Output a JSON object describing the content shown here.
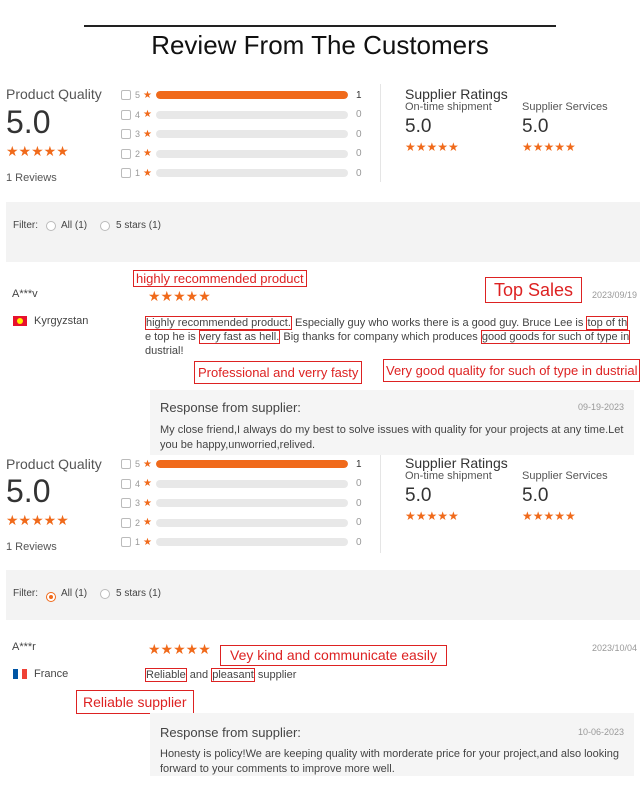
{
  "title": "Review From The Customers",
  "colors": {
    "accent": "#f06a1b",
    "annotation": "#dd2222"
  },
  "block1": {
    "product_quality_label": "Product Quality",
    "score": "5.0",
    "stars": "★★★★★",
    "reviews": "1 Reviews",
    "bars": [
      {
        "star": "5",
        "count": "1",
        "fill": 1.0
      },
      {
        "star": "4",
        "count": "0",
        "fill": 0
      },
      {
        "star": "3",
        "count": "0",
        "fill": 0
      },
      {
        "star": "2",
        "count": "0",
        "fill": 0
      },
      {
        "star": "1",
        "count": "0",
        "fill": 0
      }
    ],
    "supplier_ratings_label": "Supplier Ratings",
    "ontime_label": "On-time shipment",
    "ontime_score": "5.0",
    "service_label": "Supplier Services",
    "service_score": "5.0",
    "filter": {
      "label": "Filter:",
      "all": "All (1)",
      "five": "5 stars (1)",
      "selected": "none"
    },
    "review": {
      "reviewer": "A***v",
      "country": "Kyrgyzstan",
      "date": "2023/09/19",
      "stars": "★★★★★",
      "text_parts": {
        "p1": "highly recommended product.",
        "p2": " Especially guy who works there is a good guy. Bruce Lee is ",
        "p3": "top of th",
        "p4": "e top he is ",
        "p5": "very fast as hell.",
        "p6": " Big thanks for company which produces ",
        "p7": "good goods for such of type in",
        "p8": "dustrial!"
      }
    },
    "annotations": {
      "a1": "highly recommended product",
      "a2": "Top Sales",
      "a3": "Professional and verry fasty",
      "a4": "Very good quality for such of type in dustrial"
    },
    "response": {
      "title": "Response from supplier:",
      "date": "09-19-2023",
      "text": "My close friend,I always do my best to solve issues with quality for your projects at any time.Let you be happy,unworried,relived."
    }
  },
  "block2": {
    "product_quality_label": "Product Quality",
    "score": "5.0",
    "stars": "★★★★★",
    "reviews": "1 Reviews",
    "bars": [
      {
        "star": "5",
        "count": "1",
        "fill": 1.0
      },
      {
        "star": "4",
        "count": "0",
        "fill": 0
      },
      {
        "star": "3",
        "count": "0",
        "fill": 0
      },
      {
        "star": "2",
        "count": "0",
        "fill": 0
      },
      {
        "star": "1",
        "count": "0",
        "fill": 0
      }
    ],
    "supplier_ratings_label": "Supplier Ratings",
    "ontime_label": "On-time shipment",
    "ontime_score": "5.0",
    "service_label": "Supplier Services",
    "service_score": "5.0",
    "filter": {
      "label": "Filter:",
      "all": "All (1)",
      "five": "5 stars (1)",
      "selected": "all"
    },
    "review": {
      "reviewer": "A***r",
      "country": "France",
      "date": "2023/10/04",
      "stars": "★★★★★",
      "text_parts": {
        "p1": "Reliable",
        "p2": " and ",
        "p3": "pleasant",
        "p4": " supplier"
      }
    },
    "annotations": {
      "a1": "Vey kind and communicate easily",
      "a2": "Reliable supplier"
    },
    "response": {
      "title": "Response from supplier:",
      "date": "10-06-2023",
      "text": "Honesty is policy!We are keeping quality with morderate price for your project,and also looking forward to your comments to improve more well."
    }
  }
}
